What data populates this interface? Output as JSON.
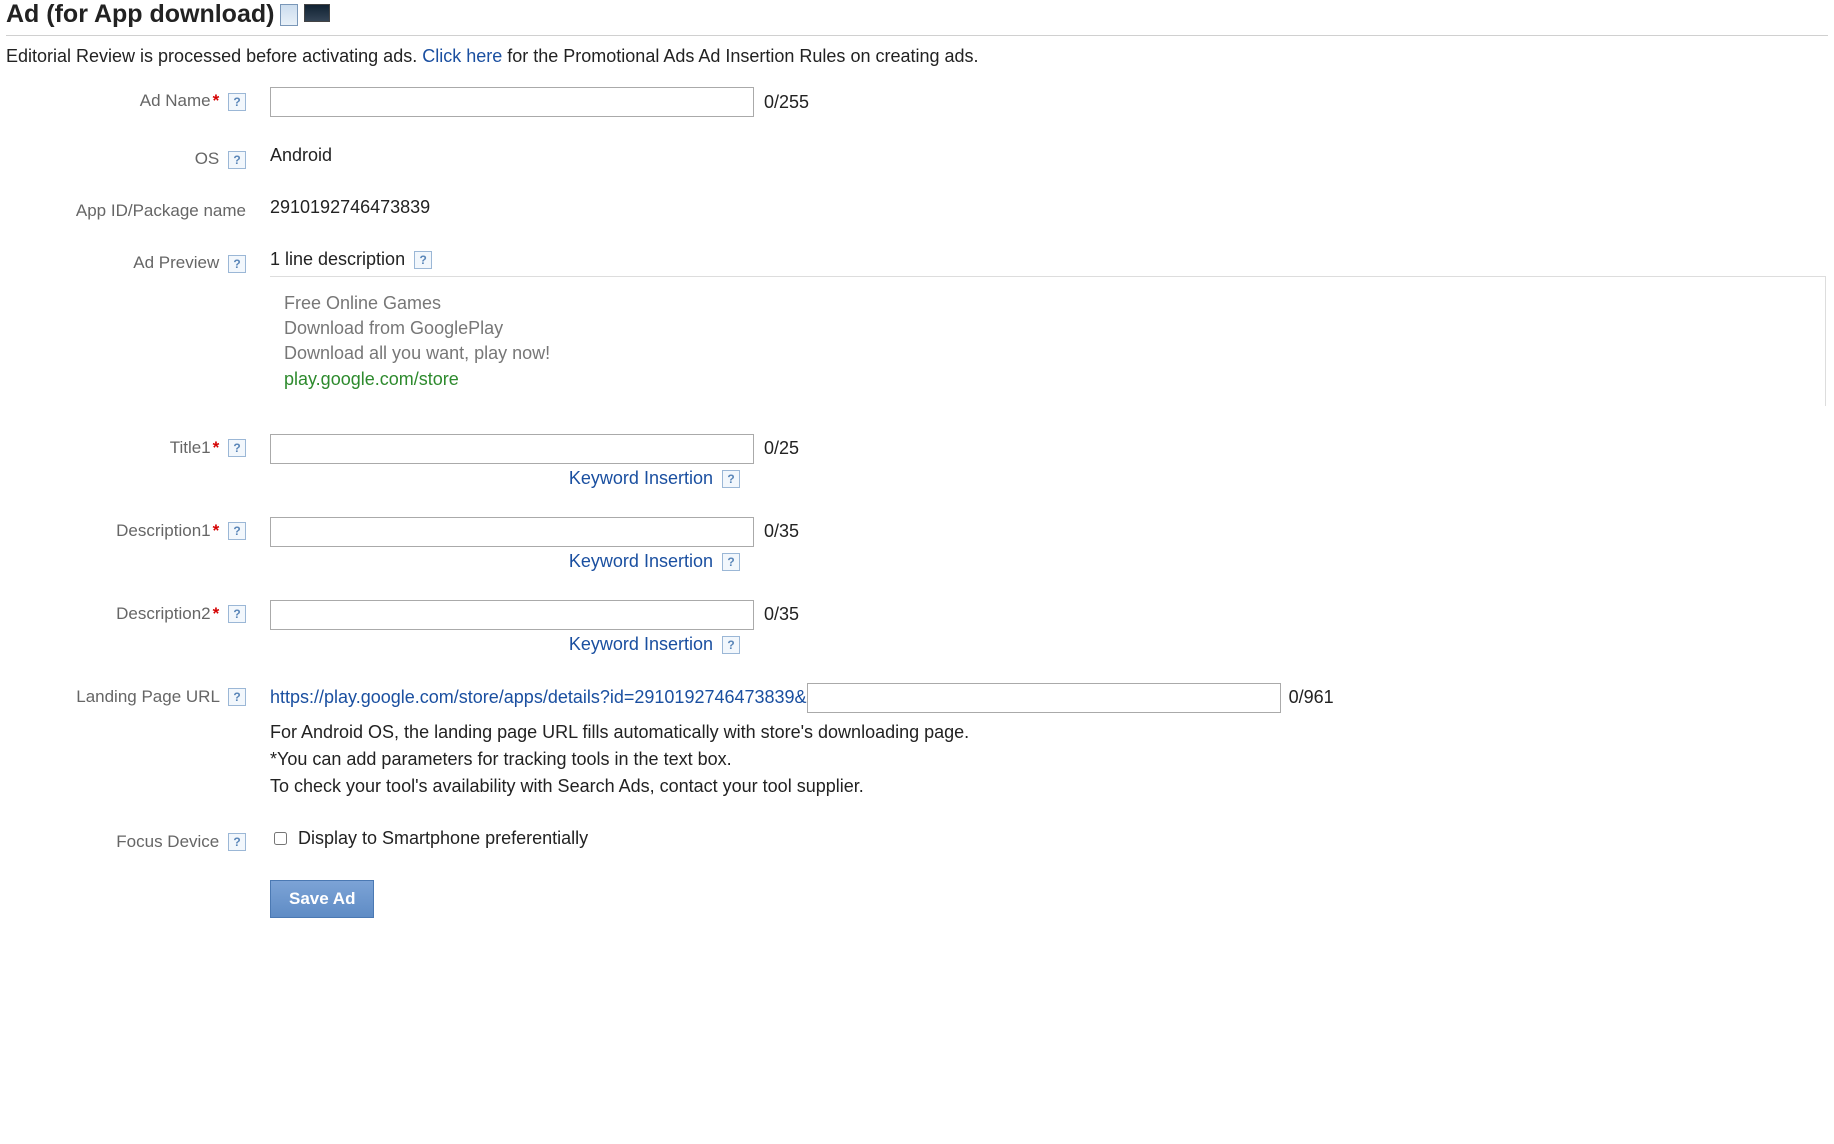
{
  "section": {
    "title": "Ad (for App download)"
  },
  "intro": {
    "prefix": "Editorial Review is processed before activating ads. ",
    "link_text": "Click here",
    "suffix": " for the Promotional Ads Ad Insertion Rules on creating ads."
  },
  "labels": {
    "ad_name": "Ad Name",
    "os": "OS",
    "app_id": "App ID/Package name",
    "ad_preview": "Ad Preview",
    "title1": "Title1",
    "description1": "Description1",
    "description2": "Description2",
    "landing_url": "Landing Page URL",
    "focus_device": "Focus Device"
  },
  "help_glyph": "?",
  "values": {
    "ad_name": "",
    "ad_name_counter": "0/255",
    "os": "Android",
    "app_id": "2910192746473839",
    "preview_heading": "1 line description",
    "preview_lines": [
      "Free Online Games",
      "Download from GooglePlay",
      "Download all you want, play now!"
    ],
    "preview_url": "play.google.com/store",
    "title1": "",
    "title1_counter": "0/25",
    "description1": "",
    "description1_counter": "0/35",
    "description2": "",
    "description2_counter": "0/35",
    "keyword_insertion_label": "Keyword Insertion",
    "landing_prefix": "https://play.google.com/store/apps/details?id=2910192746473839&",
    "landing_value": "",
    "landing_counter": "0/961",
    "landing_notes": [
      "For Android OS, the landing page URL fills automatically with store's downloading page.",
      "*You can add parameters for tracking tools in the text box.",
      "To check your tool's availability with Search Ads, contact your tool supplier."
    ],
    "focus_device_label": "Display to Smartphone preferentially",
    "focus_device_checked": false
  },
  "buttons": {
    "save": "Save Ad"
  }
}
